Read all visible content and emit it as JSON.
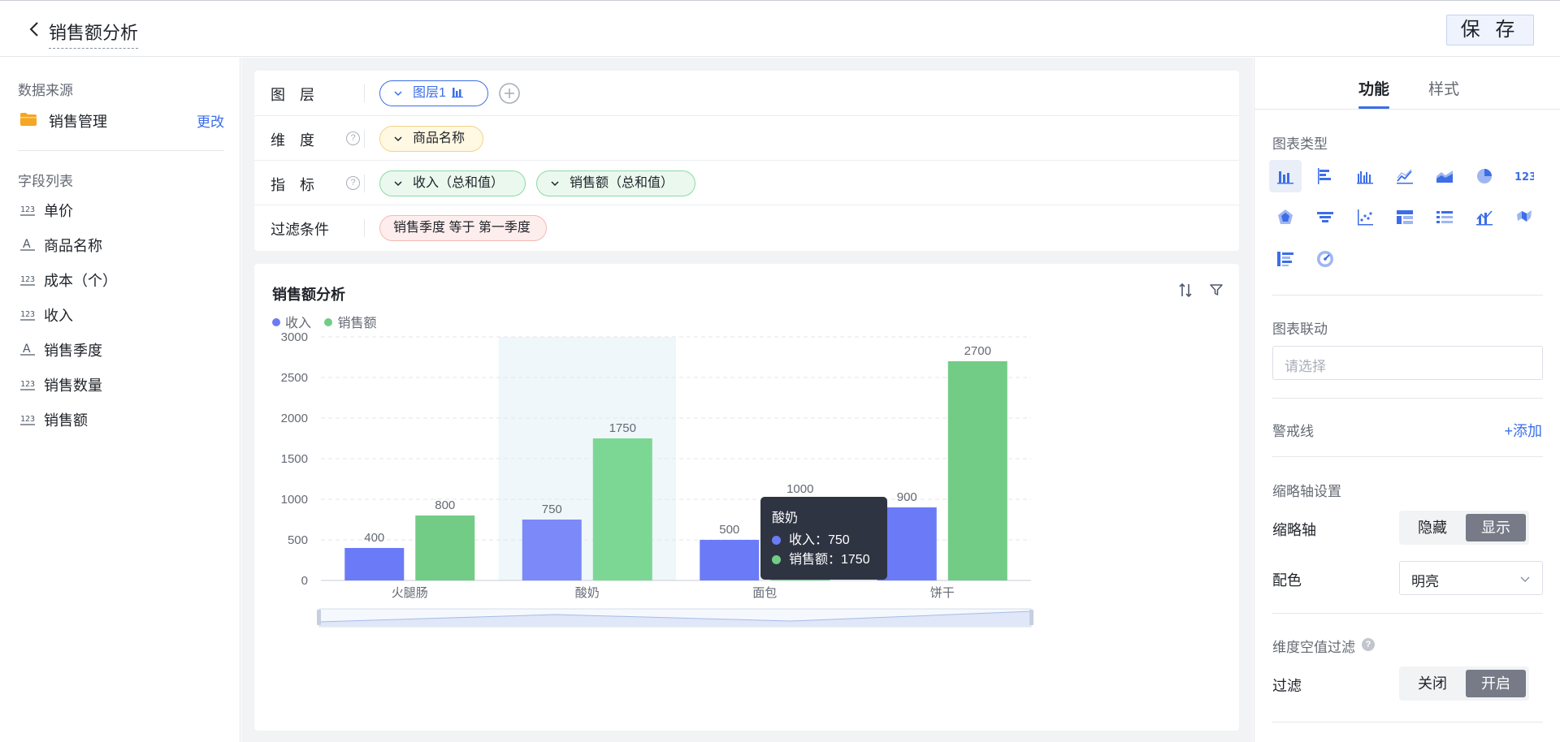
{
  "header": {
    "title": "销售额分析",
    "save_label": "保 存"
  },
  "left": {
    "datasource_title": "数据来源",
    "datasource_name": "销售管理",
    "datasource_change": "更改",
    "fields_title": "字段列表",
    "fields": [
      {
        "type": "number",
        "label": "单价"
      },
      {
        "type": "text",
        "label": "商品名称"
      },
      {
        "type": "number",
        "label": "成本（个）"
      },
      {
        "type": "number",
        "label": "收入"
      },
      {
        "type": "text",
        "label": "销售季度"
      },
      {
        "type": "number",
        "label": "销售数量"
      },
      {
        "type": "number",
        "label": "销售额"
      }
    ]
  },
  "config": {
    "layer_label": "图　层",
    "layer_pill": "图层1",
    "dimension_label": "维　度",
    "dimension_pill": "商品名称",
    "metric_label": "指　标",
    "metric_pills": [
      "收入（总和值）",
      "销售额（总和值）"
    ],
    "filter_label": "过滤条件",
    "filter_pill": "销售季度 等于 第一季度"
  },
  "chart": {
    "title": "销售额分析",
    "legend": [
      "收入",
      "销售额"
    ],
    "tooltip": {
      "title": "酸奶",
      "rows": [
        "收入：750",
        "销售额：1750"
      ]
    }
  },
  "chart_data": {
    "type": "bar",
    "categories": [
      "火腿肠",
      "酸奶",
      "面包",
      "饼干"
    ],
    "series": [
      {
        "name": "收入",
        "values": [
          400,
          750,
          500,
          900
        ],
        "color": "#6b7bf7"
      },
      {
        "name": "销售额",
        "values": [
          800,
          1750,
          1000,
          2700
        ],
        "color": "#72cc86"
      }
    ],
    "ylim": [
      0,
      3000
    ],
    "yticks": [
      0,
      500,
      1000,
      1500,
      2000,
      2500,
      3000
    ],
    "grid": true,
    "legend": "top-left",
    "highlighted_category": "酸奶"
  },
  "right": {
    "tab_function": "功能",
    "tab_style": "样式",
    "chart_type_title": "图表类型",
    "chart_link_title": "图表联动",
    "chart_link_placeholder": "请选择",
    "warning_line_title": "警戒线",
    "warning_line_add": "+添加",
    "thumb_axis_title": "缩略轴设置",
    "thumb_axis_label": "缩略轴",
    "thumb_hide": "隐藏",
    "thumb_show": "显示",
    "color_label": "配色",
    "color_value": "明亮",
    "null_filter_title": "维度空值过滤",
    "filter_label": "过滤",
    "filter_off": "关闭",
    "filter_on": "开启"
  },
  "colors": {
    "accent": "#3b6ee8",
    "income": "#6b7bf7",
    "sales": "#72cc86"
  }
}
